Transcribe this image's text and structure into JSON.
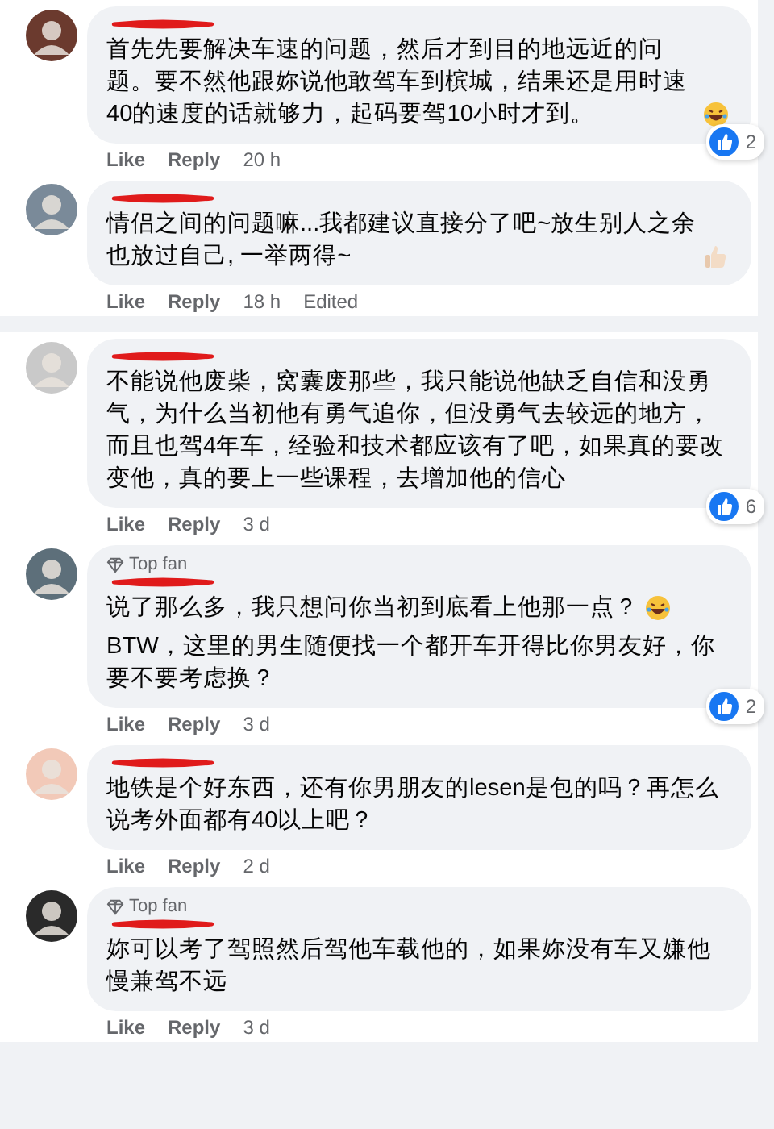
{
  "sections": [
    {
      "comments": [
        {
          "paragraphs": [
            {
              "kind": "laugh-emoji",
              "text": "首先先要解决车速的问题，然后才到目的地远近的问题。要不然他跟妳说他敢驾车到槟城，结果还是用时速40的速度的话就够力，起码要驾10小时才到。"
            }
          ],
          "like": "Like",
          "reply": "Reply",
          "time": "20 h",
          "reactions": "2"
        },
        {
          "paragraphs": [
            {
              "kind": "thumbs-emoji",
              "text": "情侣之间的问题嘛...我都建议直接分了吧~放生别人之余也放过自己, 一举两得~"
            }
          ],
          "like": "Like",
          "reply": "Reply",
          "time": "18 h",
          "edited": "Edited"
        }
      ]
    },
    {
      "comments": [
        {
          "paragraphs": [
            {
              "kind": "plain",
              "text": "不能说他废柴，窝囊废那些，我只能说他缺乏自信和没勇气，为什么当初他有勇气追你，但没勇气去较远的地方，而且也驾4年车，经验和技术都应该有了吧，如果真的要改变他，真的要上一些课程，去增加他的信心"
            }
          ],
          "like": "Like",
          "reply": "Reply",
          "time": "3 d",
          "reactions": "6"
        },
        {
          "badge": "Top fan",
          "paragraphs": [
            {
              "kind": "laugh-emoji",
              "text": "说了那么多，我只想问你当初到底看上他那一点？"
            },
            {
              "kind": "plain",
              "text": "BTW，这里的男生随便找一个都开车开得比你男友好，你要不要考虑换？"
            }
          ],
          "like": "Like",
          "reply": "Reply",
          "time": "3 d",
          "reactions": "2"
        },
        {
          "paragraphs": [
            {
              "kind": "plain",
              "text": "地铁是个好东西，还有你男朋友的lesen是包的吗？再怎么说考外面都有40以上吧？"
            }
          ],
          "like": "Like",
          "reply": "Reply",
          "time": "2 d"
        },
        {
          "badge": "Top fan",
          "paragraphs": [
            {
              "kind": "plain",
              "text": "妳可以考了驾照然后驾他车载他的，如果妳没有车又嫌他慢兼驾不远"
            }
          ],
          "like": "Like",
          "reply": "Reply",
          "time": "3 d"
        }
      ]
    }
  ]
}
